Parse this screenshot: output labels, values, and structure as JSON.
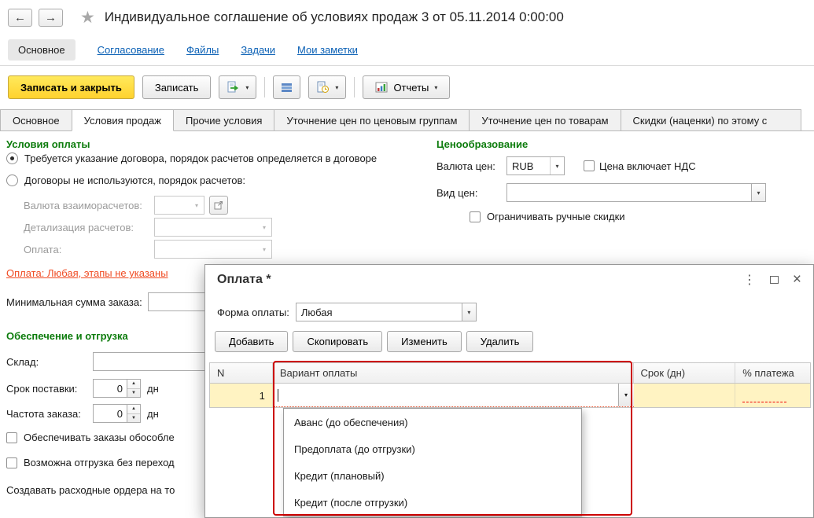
{
  "colors": {
    "accent_yellow": "#FFD22E",
    "section_green": "#0D7C0D",
    "link_blue": "#0A60B5",
    "alert_link_red": "#F04B23",
    "highlight_border_red": "#CC0000",
    "selected_row_yellow": "#FFF3C2"
  },
  "titlebar": {
    "title": "Индивидуальное соглашение об условиях продаж 3 от 05.11.2014 0:00:00"
  },
  "nav": {
    "tabs": [
      {
        "label": "Основное"
      },
      {
        "label": "Согласование"
      },
      {
        "label": "Файлы"
      },
      {
        "label": "Задачи"
      },
      {
        "label": "Мои заметки"
      }
    ]
  },
  "toolbar": {
    "save_and_close": "Записать и закрыть",
    "save": "Записать",
    "reports": "Отчеты"
  },
  "form_tabs": {
    "items": [
      "Основное",
      "Условия продаж",
      "Прочие условия",
      "Уточнение цен по ценовым группам",
      "Уточнение цен по товарам",
      "Скидки (наценки) по этому с"
    ]
  },
  "payment_terms": {
    "heading": "Условия оплаты",
    "radio_contract": "Требуется указание договора, порядок расчетов определяется в договоре",
    "radio_no_contract": "Договоры не используются, порядок расчетов:",
    "settlement_currency_label": "Валюта взаиморасчетов:",
    "settlement_detail_label": "Детализация расчетов:",
    "payment_label": "Оплата:",
    "payment_link": "Оплата: Любая, этапы не указаны",
    "min_order_label": "Минимальная сумма заказа:"
  },
  "supply": {
    "heading": "Обеспечение и отгрузка",
    "warehouse_label": "Склад:",
    "delivery_time_label": "Срок поставки:",
    "delivery_time_value": "0",
    "delivery_time_unit": "дн",
    "order_frequency_label": "Частота заказа:",
    "order_frequency_value": "0",
    "order_frequency_unit": "дн",
    "separate_orders_checkbox": "Обеспечивать заказы обособле",
    "shipment_checkbox": "Возможна отгрузка без переход",
    "expense_orders_text": "Создавать расходные ордера на то"
  },
  "pricing": {
    "heading": "Ценообразование",
    "currency_label": "Валюта цен:",
    "currency_value": "RUB",
    "vat_checkbox_label": "Цена включает НДС",
    "price_kind_label": "Вид цен:",
    "price_kind_value": "",
    "limit_manual_discounts_label": "Ограничивать ручные скидки"
  },
  "dialog": {
    "title": "Оплата *",
    "payment_form_label": "Форма оплаты:",
    "payment_form_value": "Любая",
    "buttons": [
      "Добавить",
      "Скопировать",
      "Изменить",
      "Удалить"
    ],
    "table": {
      "columns": [
        "N",
        "Вариант оплаты",
        "Срок (дн)",
        "% платежа"
      ],
      "rows": [
        {
          "n": "1",
          "variant": "",
          "term": "",
          "percent": ""
        }
      ]
    },
    "dropdown_options": [
      "Аванс (до обеспечения)",
      "Предоплата (до отгрузки)",
      "Кредит (плановый)",
      "Кредит (после отгрузки)"
    ]
  }
}
